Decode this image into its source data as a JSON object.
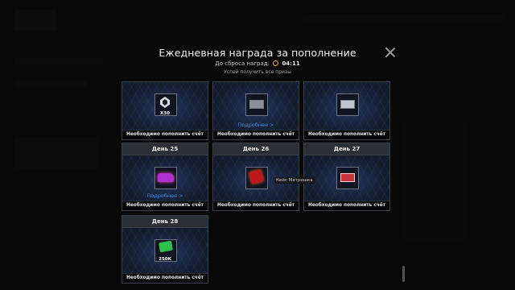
{
  "modal": {
    "title": "Ежедневная награда за пополнение",
    "reset_label": "До сброса наград:",
    "reset_time": "04:11",
    "hint": "Успей получить все призы"
  },
  "cards": [
    {
      "day": "",
      "quantity": "X30",
      "more": "",
      "footer": "Необходимо пополнить счёт",
      "item": "crystal-icon"
    },
    {
      "day": "",
      "quantity": "",
      "more": "Подробнее >",
      "footer": "Необходимо пополнить счёт",
      "item": "gray-chest-icon"
    },
    {
      "day": "",
      "quantity": "",
      "more": "",
      "footer": "Необходимо пополнить счёт",
      "item": "silver-chest-icon"
    },
    {
      "day": "День 25",
      "quantity": "",
      "more": "Подробнее >",
      "footer": "Необходимо пополнить счёт",
      "item": "purple-car-icon"
    },
    {
      "day": "День 26",
      "quantity": "",
      "more": "",
      "footer": "Необходимо пополнить счёт",
      "item": "red-box-icon"
    },
    {
      "day": "День 27",
      "quantity": "",
      "more": "",
      "footer": "Необходимо пополнить счёт",
      "item": "red-chest-icon"
    },
    {
      "day": "День 28",
      "quantity": "250K",
      "more": "",
      "footer": "Необходимо пополнить счёт",
      "item": "cash-icon"
    }
  ],
  "tooltip": "Кейс Матрешка",
  "colors": {
    "accent": "#3f8fe0",
    "timer": "#f0a000",
    "card_bg": "#1a1f28"
  }
}
